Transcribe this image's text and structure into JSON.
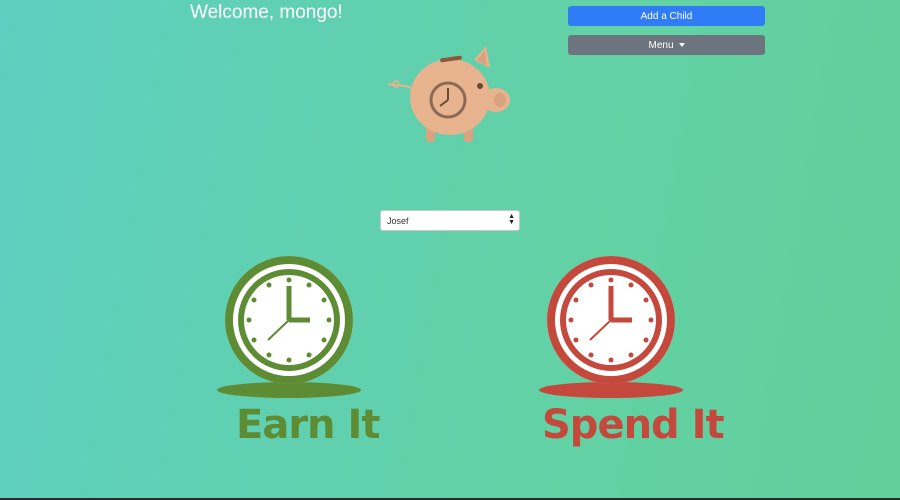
{
  "header": {
    "welcome": "Welcome, mongo!"
  },
  "buttons": {
    "add_child": "Add a Child",
    "menu": "Menu"
  },
  "child_select": {
    "selected": "Josef"
  },
  "actions": {
    "earn": "Earn It",
    "spend": "Spend It"
  },
  "colors": {
    "background_start": "#5ecfc0",
    "background_end": "#62d09a",
    "add_button": "#2f7cf6",
    "menu_button": "#6c757d",
    "earn_green": "#5e8c35",
    "spend_red": "#c5483c",
    "piggy": "#e8b48f"
  },
  "icons": {
    "logo": "piggy-bank-clock-icon",
    "earn": "green-clock-icon",
    "spend": "red-clock-icon"
  }
}
